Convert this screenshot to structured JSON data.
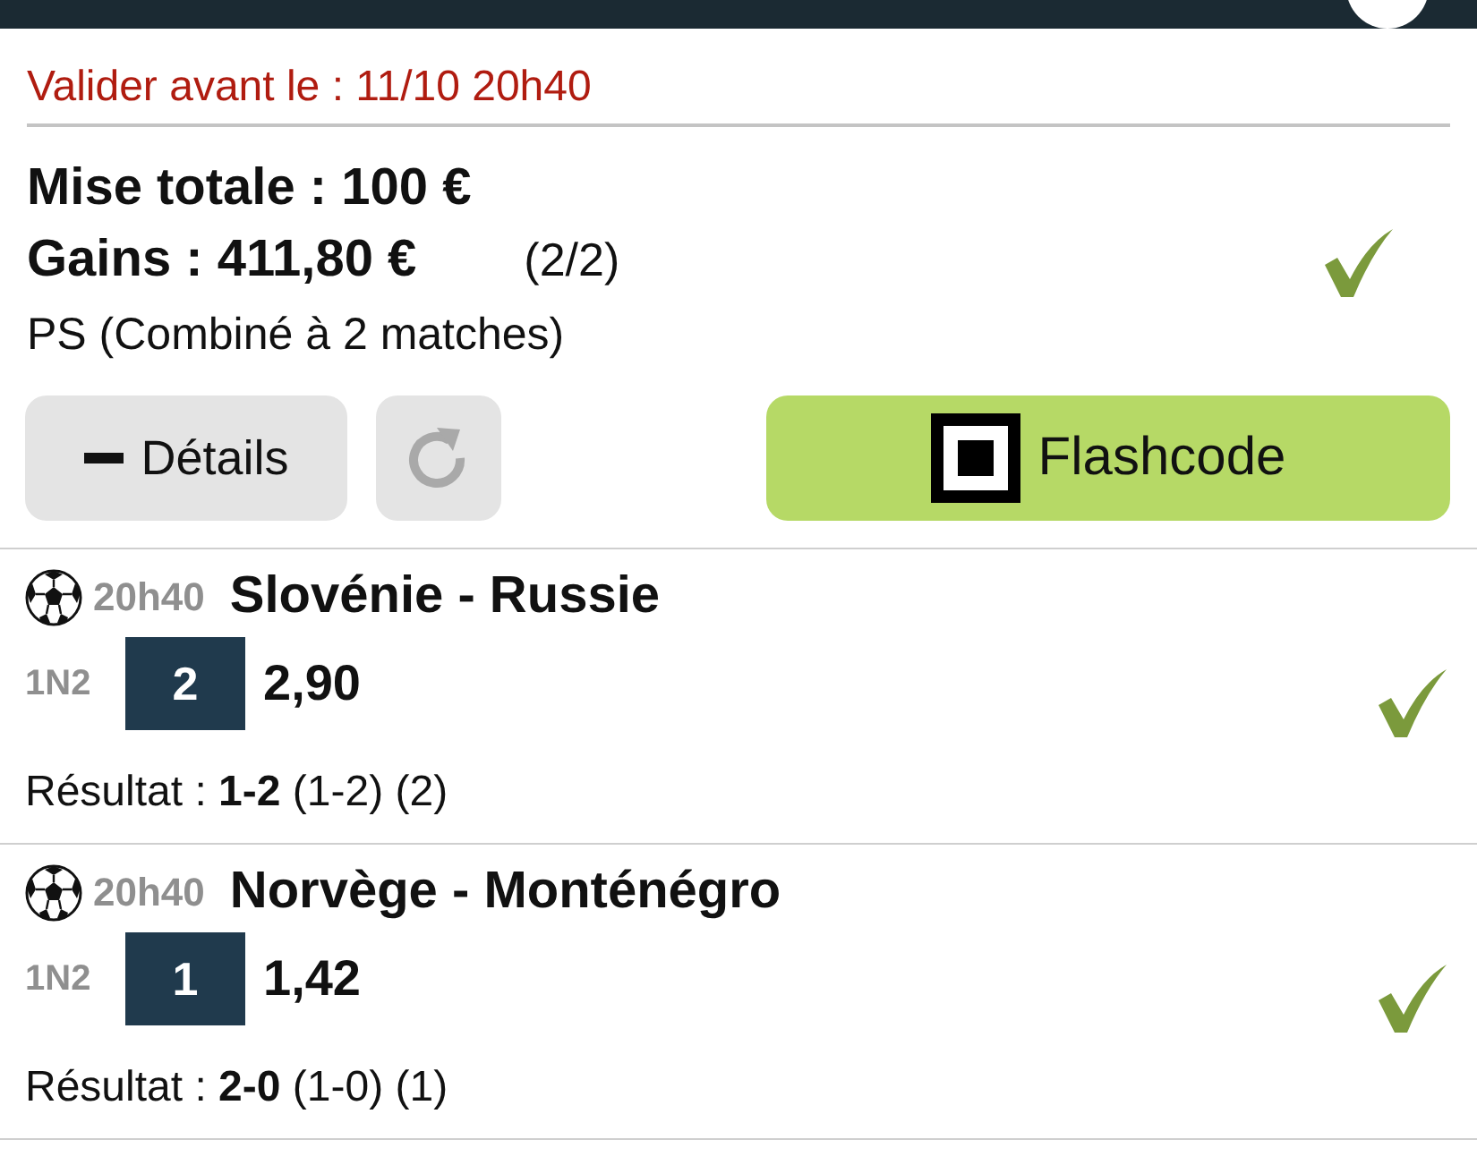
{
  "deadline": "Valider avant le : 11/10 20h40",
  "bet": {
    "stake": "Mise totale : 100 €",
    "gains": "Gains : 411,80 €",
    "count": "(2/2)",
    "type": "PS (Combiné à 2 matches)",
    "won": true
  },
  "buttons": {
    "details": "Détails",
    "flashcode": "Flashcode"
  },
  "matches": [
    {
      "time": "20h40",
      "teams": "Slovénie - Russie",
      "market": "1N2",
      "pick": "2",
      "odds": "2,90",
      "result": "Résultat : **1-2** (1-2) (2)",
      "won": true
    },
    {
      "time": "20h40",
      "teams": "Norvège - Monténégro",
      "market": "1N2",
      "pick": "1",
      "odds": "1,42",
      "result": "Résultat : **2-0** (1-0) (1)",
      "won": true
    }
  ]
}
